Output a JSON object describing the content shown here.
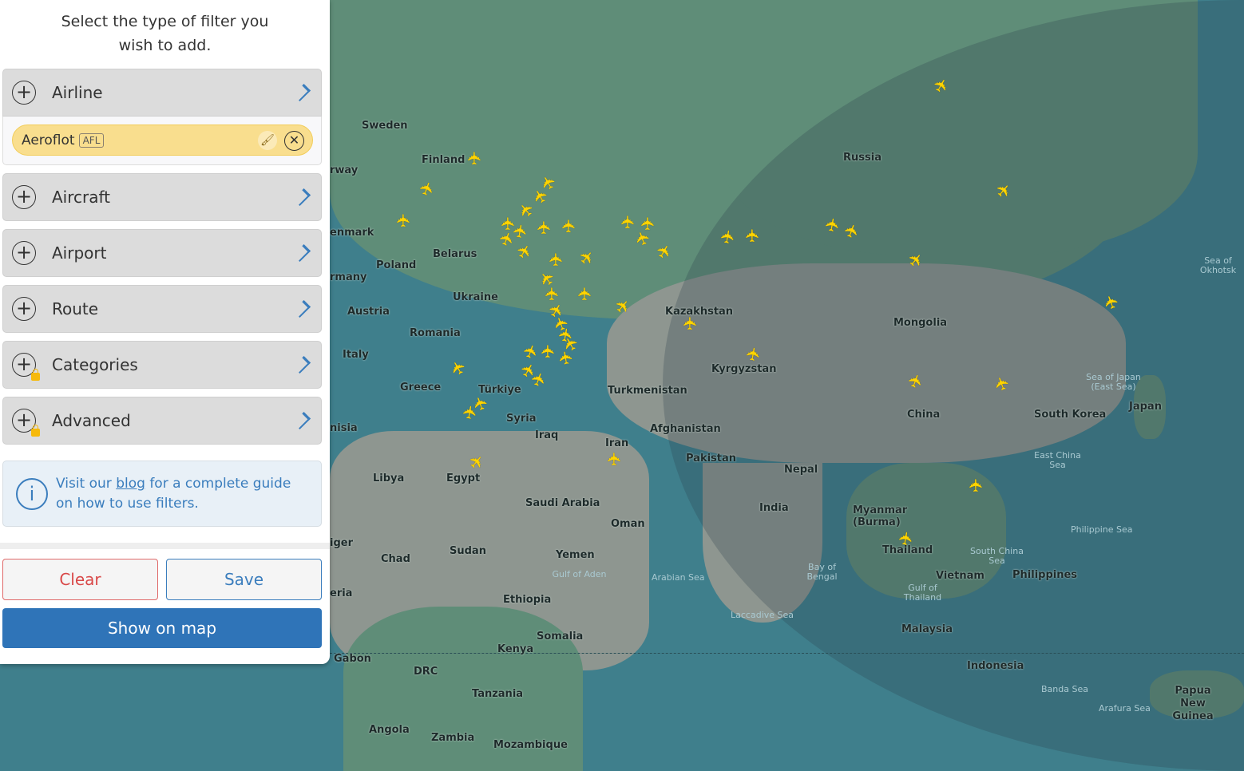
{
  "panel": {
    "title": "Select the type of filter you wish to add.",
    "filters": [
      {
        "label": "Airline",
        "locked": false
      },
      {
        "label": "Aircraft",
        "locked": false
      },
      {
        "label": "Airport",
        "locked": false
      },
      {
        "label": "Route",
        "locked": false
      },
      {
        "label": "Categories",
        "locked": true
      },
      {
        "label": "Advanced",
        "locked": true
      }
    ],
    "selected_airline": {
      "name": "Aeroflot",
      "code": "AFL"
    },
    "info": {
      "pre": "Visit our ",
      "link": "blog",
      "post": " for a complete guide on how to use filters."
    },
    "clear_label": "Clear",
    "save_label": "Save",
    "show_label": "Show on map"
  },
  "map": {
    "countries": [
      "Sweden",
      "Finland",
      "Russia",
      "Belarus",
      "Poland",
      "Ukraine",
      "Austria",
      "Romania",
      "Italy",
      "Greece",
      "Türkiye",
      "Syria",
      "Iraq",
      "Iran",
      "Kazakhstan",
      "Kyrgyzstan",
      "Turkmenistan",
      "Afghanistan",
      "Pakistan",
      "Mongolia",
      "China",
      "South Korea",
      "Japan",
      "Nepal",
      "India",
      "Myanmar (Burma)",
      "Thailand",
      "Vietnam",
      "Philippines",
      "Malaysia",
      "Indonesia",
      "Papua New Guinea",
      "Libya",
      "Egypt",
      "Saudi Arabia",
      "Oman",
      "Yemen",
      "Sudan",
      "Chad",
      "Ethiopia",
      "Somalia",
      "Kenya",
      "DRC",
      "Tanzania",
      "Angola",
      "Zambia",
      "Mozambique",
      "Gabon",
      "rway",
      "enmark",
      "rmany",
      "nisia",
      "iger",
      "eria"
    ],
    "seas": [
      "Sea of Okhotsk",
      "Sea of Japan (East Sea)",
      "East China Sea",
      "Philippine Sea",
      "South China Sea",
      "Gulf of Thailand",
      "Bay of Bengal",
      "Arabian Sea",
      "Laccadive Sea",
      "Gulf of Aden",
      "Banda Sea",
      "Arafura Sea"
    ]
  },
  "colors": {
    "accent": "#2f74b8",
    "plane": "#ffd400",
    "pill": "#f9de8e",
    "clear": "#d94848"
  }
}
